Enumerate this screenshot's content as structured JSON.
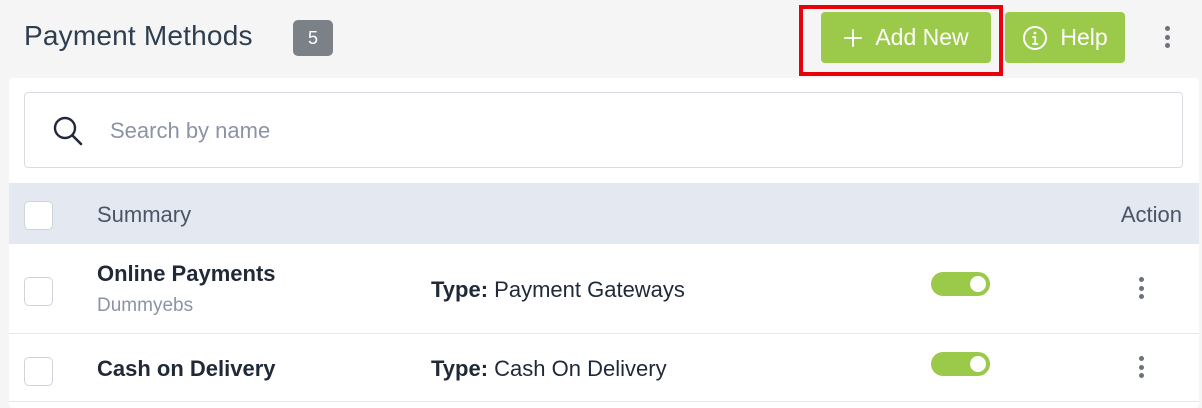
{
  "header": {
    "title": "Payment Methods",
    "count": "5",
    "add_button_label": "Add New",
    "help_button_label": "Help",
    "add_icon": "plus-icon",
    "help_icon": "info-icon",
    "more_icon": "kebab-icon"
  },
  "search": {
    "placeholder": "Search by name",
    "value": "",
    "icon": "search-icon"
  },
  "table": {
    "columns": [
      "Summary",
      "Action"
    ],
    "type_label": "Type:",
    "rows": [
      {
        "name": "Online Payments",
        "subtitle": "Dummyebs",
        "type": "Payment Gateways",
        "enabled": true
      },
      {
        "name": "Cash on Delivery",
        "subtitle": "",
        "type": "Cash On Delivery",
        "enabled": true
      }
    ]
  },
  "colors": {
    "accent": "#9bc94a",
    "highlight": "#e8000b",
    "badge": "#7b8187",
    "table_header": "#e3e8f1"
  }
}
